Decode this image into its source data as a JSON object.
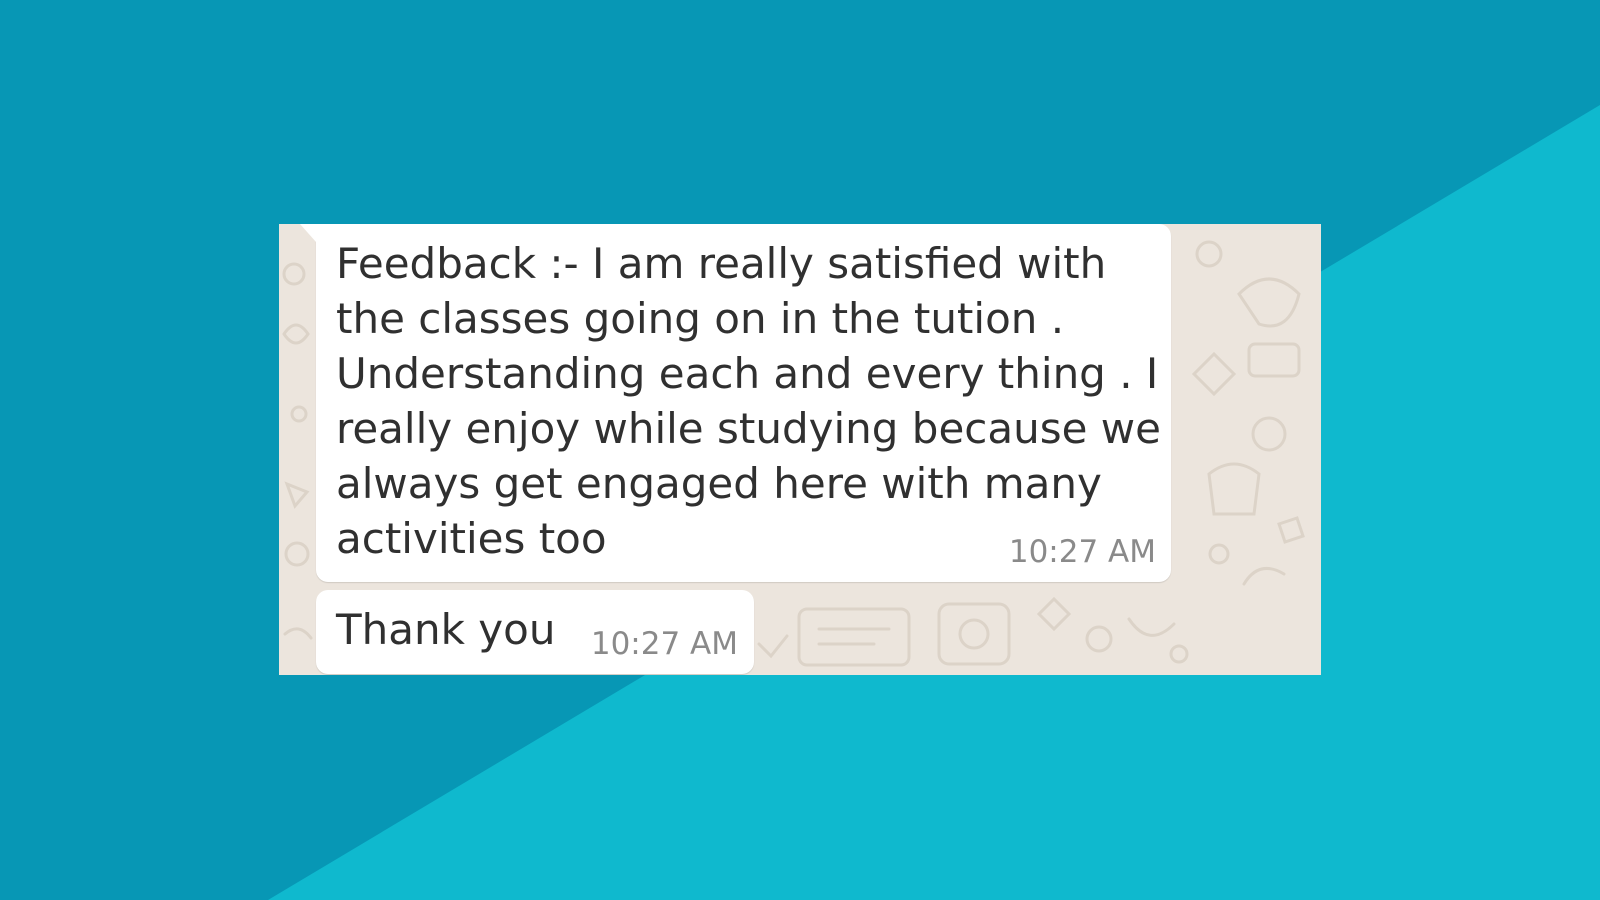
{
  "colors": {
    "background_dark": "#0797b5",
    "background_light": "#0fb9ce",
    "chat_wallpaper": "#ece5dd",
    "bubble": "#ffffff",
    "message_text": "#303030",
    "timestamp_text": "#8a8a8a"
  },
  "messages": [
    {
      "lines": [
        "Feedback :- I am really satisfied with",
        "the classes going on in the tution .",
        "Understanding each and every thing . I",
        "really enjoy while studying because we",
        "always get engaged here with many",
        "activities too"
      ],
      "time": "10:27 AM"
    },
    {
      "lines": [
        "Thank you"
      ],
      "time": "10:27 AM"
    }
  ]
}
